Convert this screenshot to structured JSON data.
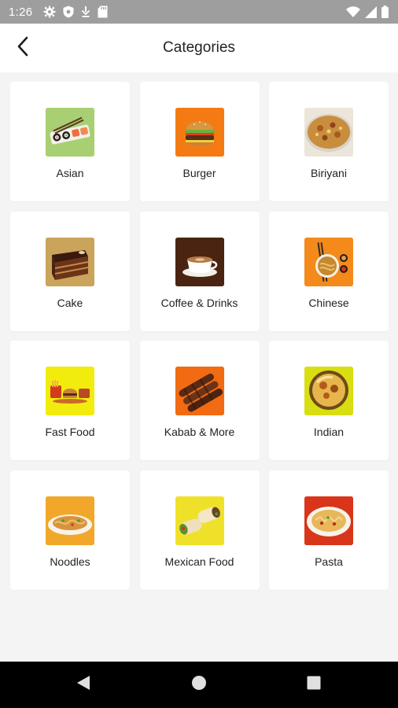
{
  "status_bar": {
    "time": "1:26",
    "icons": [
      "gear-icon",
      "shield-icon",
      "download-icon",
      "sd-card-icon",
      "wifi-icon",
      "signal-icon",
      "battery-icon"
    ]
  },
  "app_bar": {
    "title": "Categories",
    "back_icon": "back-arrow-icon"
  },
  "categories": [
    {
      "label": "Asian",
      "image": "sushi-platter",
      "bg": "#a9cf73"
    },
    {
      "label": "Burger",
      "image": "burger",
      "bg": "#f47b13"
    },
    {
      "label": "Biriyani",
      "image": "biriyani-plate",
      "bg": "#ece6da"
    },
    {
      "label": "Cake",
      "image": "chocolate-cake-slice",
      "bg": "#c9a45a"
    },
    {
      "label": "Coffee & Drinks",
      "image": "coffee-cup",
      "bg": "#4a2411"
    },
    {
      "label": "Chinese",
      "image": "chinese-dish-with-chopsticks",
      "bg": "#f48a1a"
    },
    {
      "label": "Fast Food",
      "image": "fast-food-spread",
      "bg": "#f2ec0e"
    },
    {
      "label": "Kabab & More",
      "image": "kabab",
      "bg": "#f26b12"
    },
    {
      "label": "Indian",
      "image": "indian-curry-bowl",
      "bg": "#d8de12"
    },
    {
      "label": "Noodles",
      "image": "noodles-plate",
      "bg": "#f1a82a"
    },
    {
      "label": "Mexican Food",
      "image": "wraps",
      "bg": "#efe12a"
    },
    {
      "label": "Pasta",
      "image": "pasta-plate",
      "bg": "#d9351a"
    }
  ],
  "nav_bar": {
    "buttons": [
      "back-triangle-icon",
      "home-circle-icon",
      "recents-square-icon"
    ]
  }
}
